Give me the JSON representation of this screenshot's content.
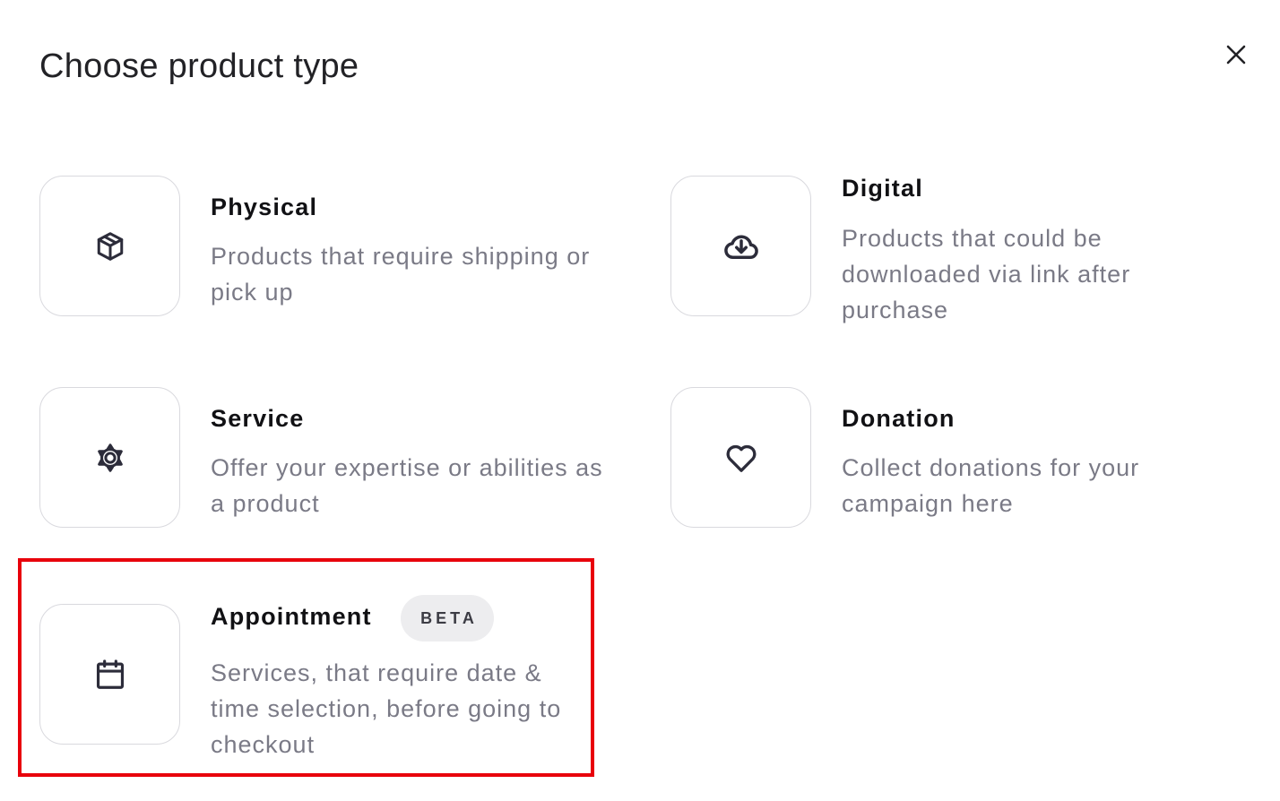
{
  "modal": {
    "title": "Choose product type",
    "close_icon": "close-icon"
  },
  "options": [
    {
      "id": "physical",
      "title": "Physical",
      "description": "Products that require shipping or pick up",
      "icon": "box-icon"
    },
    {
      "id": "digital",
      "title": "Digital",
      "description": "Products that could be downloaded via link after purchase",
      "icon": "cloud-download-icon"
    },
    {
      "id": "service",
      "title": "Service",
      "description": "Offer your expertise or abilities as a product",
      "icon": "gear-icon"
    },
    {
      "id": "donation",
      "title": "Donation",
      "description": "Collect donations for your campaign here",
      "icon": "heart-icon"
    },
    {
      "id": "appointment",
      "title": "Appointment",
      "badge": "BETA",
      "description": "Services, that require date & time selection, before going to checkout",
      "icon": "calendar-icon"
    }
  ],
  "colors": {
    "highlight": "#e8000b",
    "description_text": "#7a7a86",
    "border": "#d9d9de",
    "badge_bg": "#ededef"
  }
}
